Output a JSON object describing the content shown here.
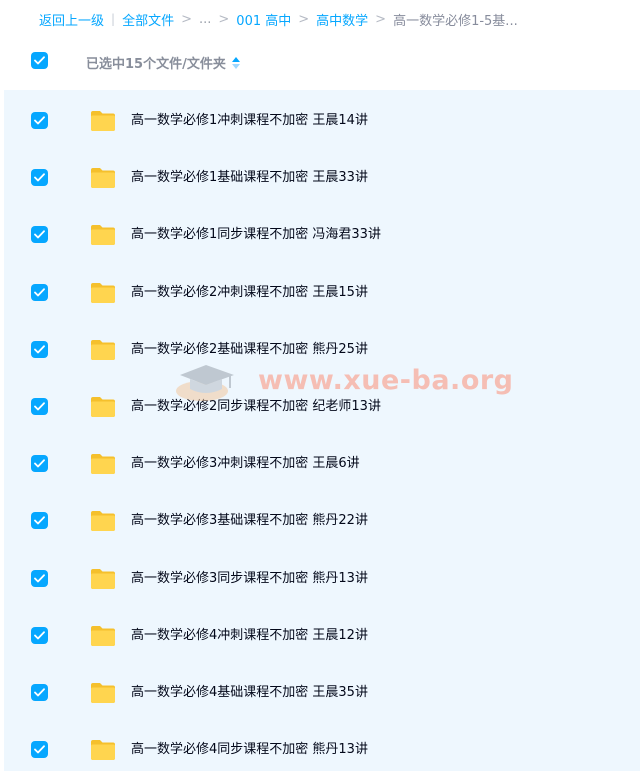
{
  "breadcrumb": {
    "back": "返回上一级",
    "all_files": "全部文件",
    "dots": "...",
    "level1": "001 高中",
    "level2": "高中数学",
    "current": "高一数学必修1-5基..."
  },
  "header": {
    "selected_label": "已选中15个文件/文件夹"
  },
  "watermark": {
    "text": "www.xue-ba.org"
  },
  "colors": {
    "accent": "#06a7ff",
    "list_bg": "#eef7fe",
    "folder": "#ffd24d"
  },
  "rows": [
    {
      "name": "高一数学必修1冲刺课程不加密 王晨14讲",
      "checked": true
    },
    {
      "name": "高一数学必修1基础课程不加密 王晨33讲",
      "checked": true
    },
    {
      "name": "高一数学必修1同步课程不加密 冯海君33讲",
      "checked": true
    },
    {
      "name": "高一数学必修2冲刺课程不加密 王晨15讲",
      "checked": true
    },
    {
      "name": "高一数学必修2基础课程不加密 熊丹25讲",
      "checked": true
    },
    {
      "name": "高一数学必修2同步课程不加密 纪老师13讲",
      "checked": true
    },
    {
      "name": "高一数学必修3冲刺课程不加密 王晨6讲",
      "checked": true
    },
    {
      "name": "高一数学必修3基础课程不加密 熊丹22讲",
      "checked": true
    },
    {
      "name": "高一数学必修3同步课程不加密 熊丹13讲",
      "checked": true
    },
    {
      "name": "高一数学必修4冲刺课程不加密 王晨12讲",
      "checked": true
    },
    {
      "name": "高一数学必修4基础课程不加密 王晨35讲",
      "checked": true
    },
    {
      "name": "高一数学必修4同步课程不加密 熊丹13讲",
      "checked": true
    }
  ]
}
